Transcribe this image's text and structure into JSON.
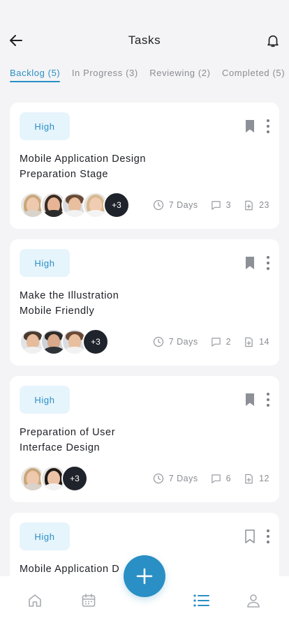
{
  "header": {
    "title": "Tasks",
    "back_icon": "arrow-left-icon",
    "notification_icon": "bell-icon"
  },
  "tabs": [
    {
      "label": "Backlog (5)",
      "active": true
    },
    {
      "label": "In Progress (3)",
      "active": false
    },
    {
      "label": "Reviewing (2)",
      "active": false
    },
    {
      "label": "Completed (5)",
      "active": false
    }
  ],
  "tasks": [
    {
      "priority": "High",
      "title_line1": "Mobile Application Design",
      "title_line2": "Preparation Stage",
      "avatars_extra": "+3",
      "duration": "7 Days",
      "comments": "3",
      "files": "23",
      "bookmarked": true
    },
    {
      "priority": "High",
      "title_line1": "Make the Illustration",
      "title_line2": "Mobile Friendly",
      "avatars_extra": "+3",
      "duration": "7 Days",
      "comments": "2",
      "files": "14",
      "bookmarked": true
    },
    {
      "priority": "High",
      "title_line1": "Preparation of User",
      "title_line2": "Interface Design",
      "avatars_extra": "+3",
      "duration": "7 Days",
      "comments": "6",
      "files": "12",
      "bookmarked": true
    },
    {
      "priority": "High",
      "title_line1": "Mobile Application D",
      "title_line2": "",
      "bookmarked": false
    }
  ],
  "bottom_nav": [
    "home-icon",
    "calendar-icon",
    "list-icon",
    "profile-icon"
  ],
  "active_nav": "list-icon",
  "colors": {
    "accent": "#2a8fc4",
    "badge_bg": "#e6f4fc",
    "background": "#f4f4f6",
    "dark_avatar": "#1f232b"
  }
}
